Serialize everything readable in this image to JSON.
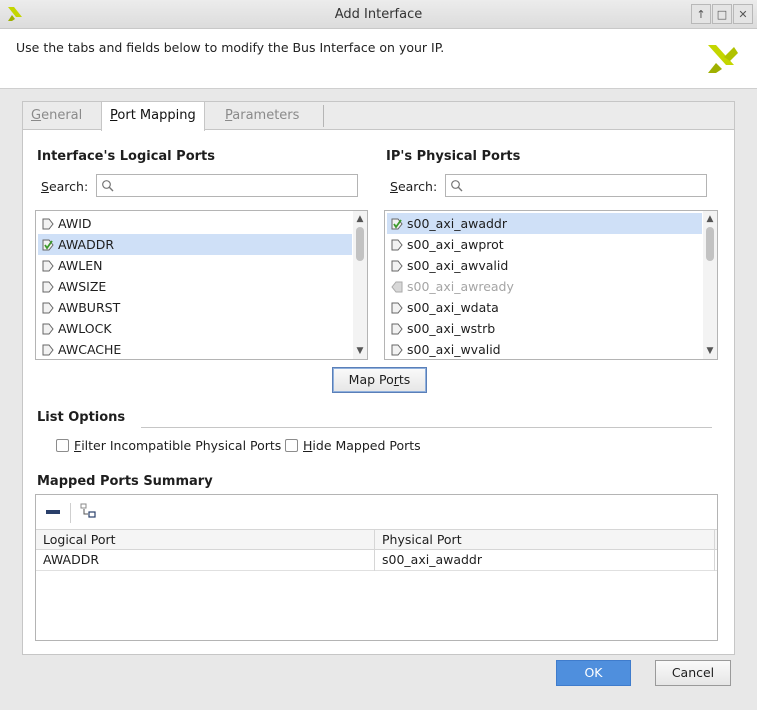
{
  "window": {
    "title": "Add Interface",
    "controls": [
      "↑",
      "□",
      "✕"
    ]
  },
  "header": {
    "description": "Use the tabs and fields below to modify the Bus Interface on your IP."
  },
  "tabs": [
    {
      "label_first": "G",
      "label_rest": "eneral",
      "active": false
    },
    {
      "label_first": "P",
      "label_rest": "ort Mapping",
      "active": true
    },
    {
      "label_first": "P",
      "label_rest": "arameters",
      "active": false
    }
  ],
  "logical": {
    "title": "Interface's Logical Ports",
    "search_label_first": "S",
    "search_label_rest": "earch:",
    "search_value": "",
    "items": [
      {
        "label": "AWID",
        "selected": false,
        "mapped": false
      },
      {
        "label": "AWADDR",
        "selected": true,
        "mapped": true
      },
      {
        "label": "AWLEN",
        "selected": false,
        "mapped": false
      },
      {
        "label": "AWSIZE",
        "selected": false,
        "mapped": false
      },
      {
        "label": "AWBURST",
        "selected": false,
        "mapped": false
      },
      {
        "label": "AWLOCK",
        "selected": false,
        "mapped": false
      },
      {
        "label": "AWCACHE",
        "selected": false,
        "mapped": false
      }
    ]
  },
  "physical": {
    "title": "IP's Physical Ports",
    "search_label_first": "S",
    "search_label_rest": "earch:",
    "search_value": "",
    "items": [
      {
        "label": "s00_axi_awaddr",
        "selected": true,
        "mapped": true,
        "direction": "in"
      },
      {
        "label": "s00_axi_awprot",
        "selected": false,
        "mapped": false,
        "direction": "in"
      },
      {
        "label": "s00_axi_awvalid",
        "selected": false,
        "mapped": false,
        "direction": "in"
      },
      {
        "label": "s00_axi_awready",
        "selected": false,
        "mapped": false,
        "direction": "out",
        "disabled": true
      },
      {
        "label": "s00_axi_wdata",
        "selected": false,
        "mapped": false,
        "direction": "in"
      },
      {
        "label": "s00_axi_wstrb",
        "selected": false,
        "mapped": false,
        "direction": "in"
      },
      {
        "label": "s00_axi_wvalid",
        "selected": false,
        "mapped": false,
        "direction": "in"
      }
    ]
  },
  "map_ports": {
    "label_pre": "Map Po",
    "label_ul": "r",
    "label_post": "ts"
  },
  "list_options": {
    "title": "List Options",
    "filter": {
      "label_first": "F",
      "label_rest": "ilter Incompatible Physical Ports",
      "checked": false
    },
    "hide": {
      "label_first": "H",
      "label_rest": "ide Mapped Ports",
      "checked": false
    }
  },
  "summary": {
    "title": "Mapped Ports Summary",
    "columns": [
      "Logical Port",
      "Physical Port"
    ],
    "rows": [
      [
        "AWADDR",
        "s00_axi_awaddr"
      ]
    ]
  },
  "footer": {
    "ok_label": "OK",
    "cancel_label": "Cancel"
  },
  "colors": {
    "selection": "#cfe0f7",
    "primary_button": "#4f8fdd",
    "logo": "#c4d600"
  }
}
